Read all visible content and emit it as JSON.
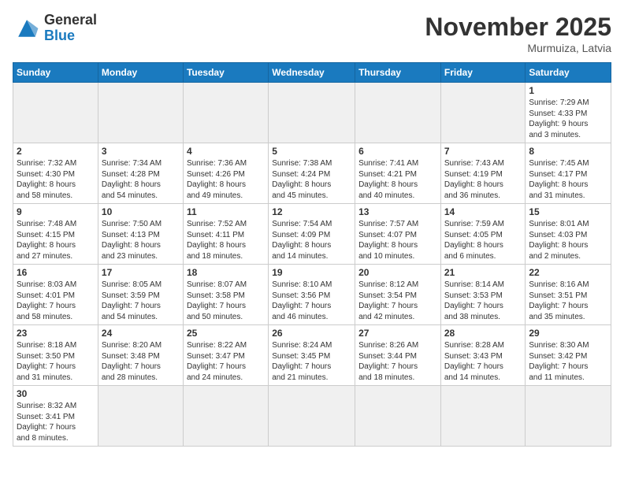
{
  "logo": {
    "general": "General",
    "blue": "Blue"
  },
  "title": "November 2025",
  "subtitle": "Murmuiza, Latvia",
  "weekdays": [
    "Sunday",
    "Monday",
    "Tuesday",
    "Wednesday",
    "Thursday",
    "Friday",
    "Saturday"
  ],
  "weeks": [
    [
      {
        "day": "",
        "info": ""
      },
      {
        "day": "",
        "info": ""
      },
      {
        "day": "",
        "info": ""
      },
      {
        "day": "",
        "info": ""
      },
      {
        "day": "",
        "info": ""
      },
      {
        "day": "",
        "info": ""
      },
      {
        "day": "1",
        "info": "Sunrise: 7:29 AM\nSunset: 4:33 PM\nDaylight: 9 hours\nand 3 minutes."
      }
    ],
    [
      {
        "day": "2",
        "info": "Sunrise: 7:32 AM\nSunset: 4:30 PM\nDaylight: 8 hours\nand 58 minutes."
      },
      {
        "day": "3",
        "info": "Sunrise: 7:34 AM\nSunset: 4:28 PM\nDaylight: 8 hours\nand 54 minutes."
      },
      {
        "day": "4",
        "info": "Sunrise: 7:36 AM\nSunset: 4:26 PM\nDaylight: 8 hours\nand 49 minutes."
      },
      {
        "day": "5",
        "info": "Sunrise: 7:38 AM\nSunset: 4:24 PM\nDaylight: 8 hours\nand 45 minutes."
      },
      {
        "day": "6",
        "info": "Sunrise: 7:41 AM\nSunset: 4:21 PM\nDaylight: 8 hours\nand 40 minutes."
      },
      {
        "day": "7",
        "info": "Sunrise: 7:43 AM\nSunset: 4:19 PM\nDaylight: 8 hours\nand 36 minutes."
      },
      {
        "day": "8",
        "info": "Sunrise: 7:45 AM\nSunset: 4:17 PM\nDaylight: 8 hours\nand 31 minutes."
      }
    ],
    [
      {
        "day": "9",
        "info": "Sunrise: 7:48 AM\nSunset: 4:15 PM\nDaylight: 8 hours\nand 27 minutes."
      },
      {
        "day": "10",
        "info": "Sunrise: 7:50 AM\nSunset: 4:13 PM\nDaylight: 8 hours\nand 23 minutes."
      },
      {
        "day": "11",
        "info": "Sunrise: 7:52 AM\nSunset: 4:11 PM\nDaylight: 8 hours\nand 18 minutes."
      },
      {
        "day": "12",
        "info": "Sunrise: 7:54 AM\nSunset: 4:09 PM\nDaylight: 8 hours\nand 14 minutes."
      },
      {
        "day": "13",
        "info": "Sunrise: 7:57 AM\nSunset: 4:07 PM\nDaylight: 8 hours\nand 10 minutes."
      },
      {
        "day": "14",
        "info": "Sunrise: 7:59 AM\nSunset: 4:05 PM\nDaylight: 8 hours\nand 6 minutes."
      },
      {
        "day": "15",
        "info": "Sunrise: 8:01 AM\nSunset: 4:03 PM\nDaylight: 8 hours\nand 2 minutes."
      }
    ],
    [
      {
        "day": "16",
        "info": "Sunrise: 8:03 AM\nSunset: 4:01 PM\nDaylight: 7 hours\nand 58 minutes."
      },
      {
        "day": "17",
        "info": "Sunrise: 8:05 AM\nSunset: 3:59 PM\nDaylight: 7 hours\nand 54 minutes."
      },
      {
        "day": "18",
        "info": "Sunrise: 8:07 AM\nSunset: 3:58 PM\nDaylight: 7 hours\nand 50 minutes."
      },
      {
        "day": "19",
        "info": "Sunrise: 8:10 AM\nSunset: 3:56 PM\nDaylight: 7 hours\nand 46 minutes."
      },
      {
        "day": "20",
        "info": "Sunrise: 8:12 AM\nSunset: 3:54 PM\nDaylight: 7 hours\nand 42 minutes."
      },
      {
        "day": "21",
        "info": "Sunrise: 8:14 AM\nSunset: 3:53 PM\nDaylight: 7 hours\nand 38 minutes."
      },
      {
        "day": "22",
        "info": "Sunrise: 8:16 AM\nSunset: 3:51 PM\nDaylight: 7 hours\nand 35 minutes."
      }
    ],
    [
      {
        "day": "23",
        "info": "Sunrise: 8:18 AM\nSunset: 3:50 PM\nDaylight: 7 hours\nand 31 minutes."
      },
      {
        "day": "24",
        "info": "Sunrise: 8:20 AM\nSunset: 3:48 PM\nDaylight: 7 hours\nand 28 minutes."
      },
      {
        "day": "25",
        "info": "Sunrise: 8:22 AM\nSunset: 3:47 PM\nDaylight: 7 hours\nand 24 minutes."
      },
      {
        "day": "26",
        "info": "Sunrise: 8:24 AM\nSunset: 3:45 PM\nDaylight: 7 hours\nand 21 minutes."
      },
      {
        "day": "27",
        "info": "Sunrise: 8:26 AM\nSunset: 3:44 PM\nDaylight: 7 hours\nand 18 minutes."
      },
      {
        "day": "28",
        "info": "Sunrise: 8:28 AM\nSunset: 3:43 PM\nDaylight: 7 hours\nand 14 minutes."
      },
      {
        "day": "29",
        "info": "Sunrise: 8:30 AM\nSunset: 3:42 PM\nDaylight: 7 hours\nand 11 minutes."
      }
    ],
    [
      {
        "day": "30",
        "info": "Sunrise: 8:32 AM\nSunset: 3:41 PM\nDaylight: 7 hours\nand 8 minutes."
      },
      {
        "day": "",
        "info": ""
      },
      {
        "day": "",
        "info": ""
      },
      {
        "day": "",
        "info": ""
      },
      {
        "day": "",
        "info": ""
      },
      {
        "day": "",
        "info": ""
      },
      {
        "day": "",
        "info": ""
      }
    ]
  ]
}
